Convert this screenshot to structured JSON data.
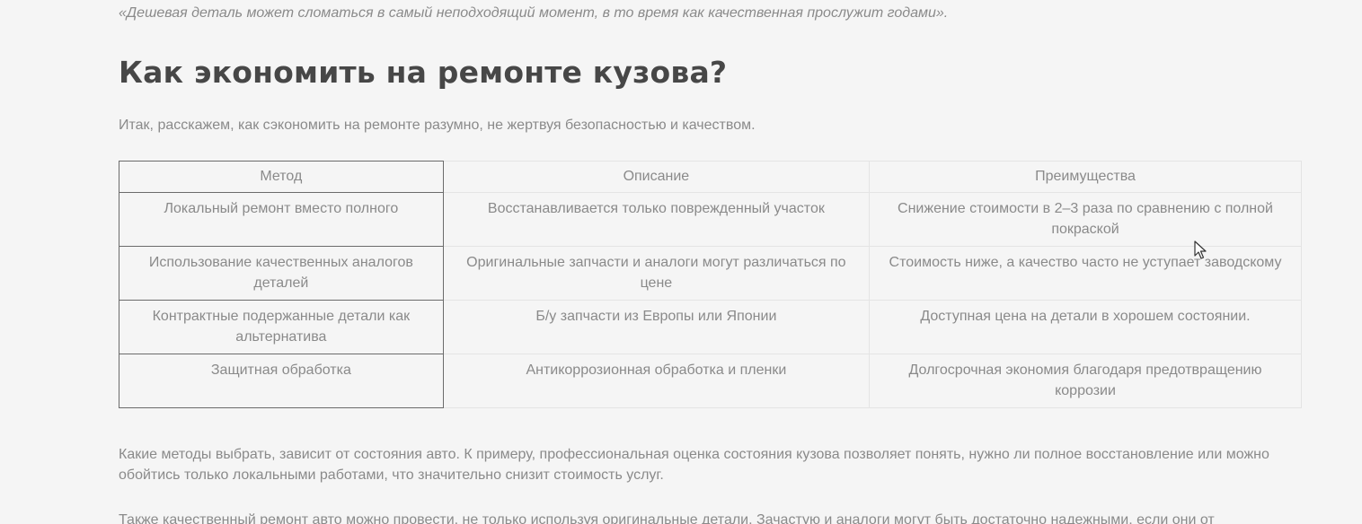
{
  "article": {
    "quote": "«Дешевая деталь может сломаться в самый неподходящий момент, в то время как качественная прослужит годами».",
    "heading": "Как экономить на ремонте кузова?",
    "intro": "Итак, расскажем, как сэкономить на ремонте разумно, не жертвуя безопасностью и качеством.",
    "table": {
      "headers": [
        "Метод",
        "Описание",
        "Преимущества"
      ],
      "rows": [
        [
          "Локальный ремонт вместо полного",
          "Восстанавливается только поврежденный участок",
          "Снижение стоимости в 2–3 раза по сравнению с полной покраской"
        ],
        [
          "Использование качественных аналогов деталей",
          "Оригинальные запчасти и аналоги могут различаться по цене",
          "Стоимость ниже, а качество часто не уступает заводскому"
        ],
        [
          "Контрактные подержанные детали как альтернатива",
          "Б/у запчасти из Европы или Японии",
          "Доступная цена на детали в хорошем состоянии."
        ],
        [
          "Защитная обработка",
          "Антикоррозионная обработка и пленки",
          "Долгосрочная экономия благодаря предотвращению коррозии"
        ]
      ]
    },
    "paragraph1": "Какие методы выбрать, зависит от состояния авто. К примеру, профессиональная оценка состояния кузова позволяет понять, нужно ли полное восстановление или можно обойтись только локальными работами, что значительно снизит стоимость услуг.",
    "paragraph2": "Также качественный ремонт авто можно провести, не только используя оригинальные детали. Зачастую и аналоги могут быть достаточно надежными, если они от"
  },
  "cursor": {
    "icon": "mouse-pointer-icon"
  }
}
